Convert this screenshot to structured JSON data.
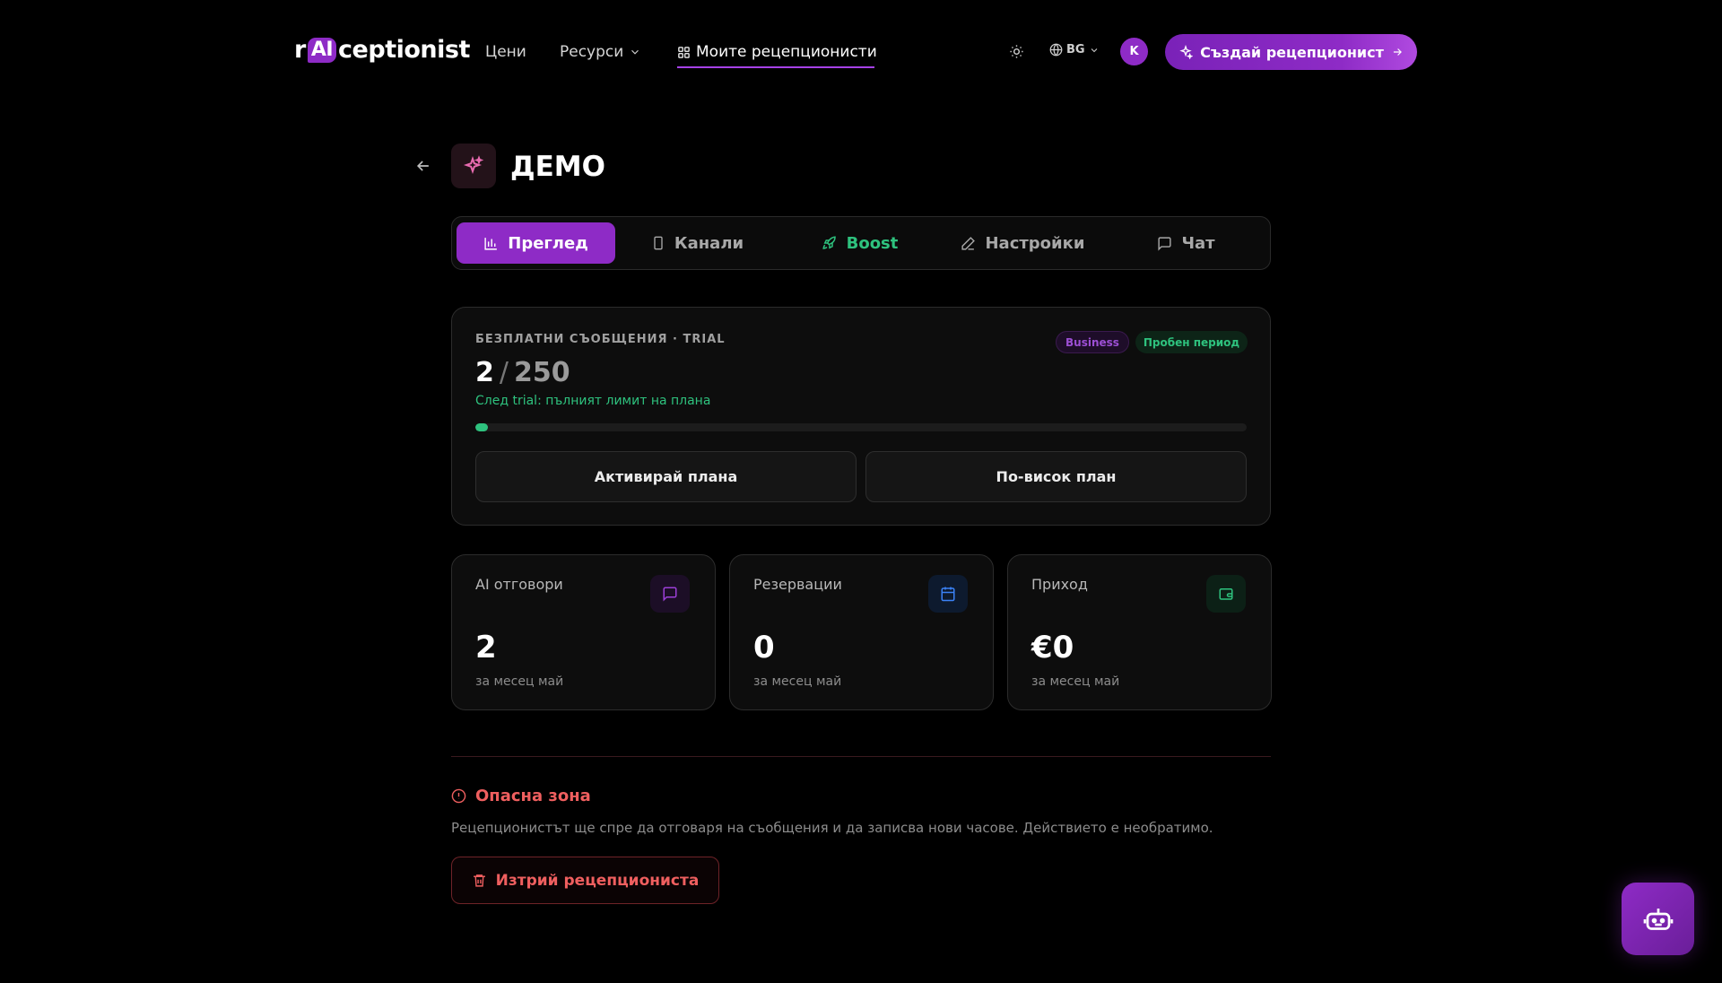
{
  "header": {
    "logo": {
      "prefix": "r",
      "ai": "AI",
      "suffix": "ceptionist"
    },
    "nav": {
      "pricing": "Цени",
      "resources": "Ресурси",
      "my_receptionists": "Моите рецепционисти"
    },
    "lang": "BG",
    "avatar": "K",
    "create_button": "Създай рецепционист"
  },
  "page": {
    "title": "ДЕМО"
  },
  "tabs": [
    {
      "label": "Преглед",
      "icon": "bar-chart-icon",
      "active": true
    },
    {
      "label": "Канали",
      "icon": "phone-icon"
    },
    {
      "label": "Boost",
      "icon": "rocket-icon"
    },
    {
      "label": "Настройки",
      "icon": "pencil-icon"
    },
    {
      "label": "Чат",
      "icon": "message-icon"
    }
  ],
  "usage": {
    "label": "БЕЗПЛАТНИ СЪОБЩЕНИЯ · TRIAL",
    "used": "2",
    "separator": "/",
    "total": "250",
    "note": "След trial: пълният лимит на плана",
    "progress_fraction": 0.008,
    "badges": {
      "plan": "Business",
      "status": "Пробен период"
    },
    "buttons": {
      "activate": "Активирай плана",
      "upgrade": "По-висок план"
    }
  },
  "stats": [
    {
      "label": "AI отговори",
      "value": "2",
      "sub": "за месец май",
      "icon": "message-icon",
      "accent": "#8e2bc6"
    },
    {
      "label": "Резервации",
      "value": "0",
      "sub": "за месец май",
      "icon": "calendar-icon",
      "accent": "#3b82f6"
    },
    {
      "label": "Приход",
      "value": "€0",
      "sub": "за месец май",
      "icon": "wallet-icon",
      "accent": "#2ec27e"
    }
  ],
  "danger": {
    "title": "Опасна зона",
    "text": "Рецепционистът ще спре да отговаря на съобщения и да записва нови часове. Действието е необратимо.",
    "delete_button": "Изтрий рецепциониста"
  },
  "colors": {
    "accent": "#8e2bc6",
    "success": "#2ec27e",
    "danger": "#ef5f5f"
  }
}
